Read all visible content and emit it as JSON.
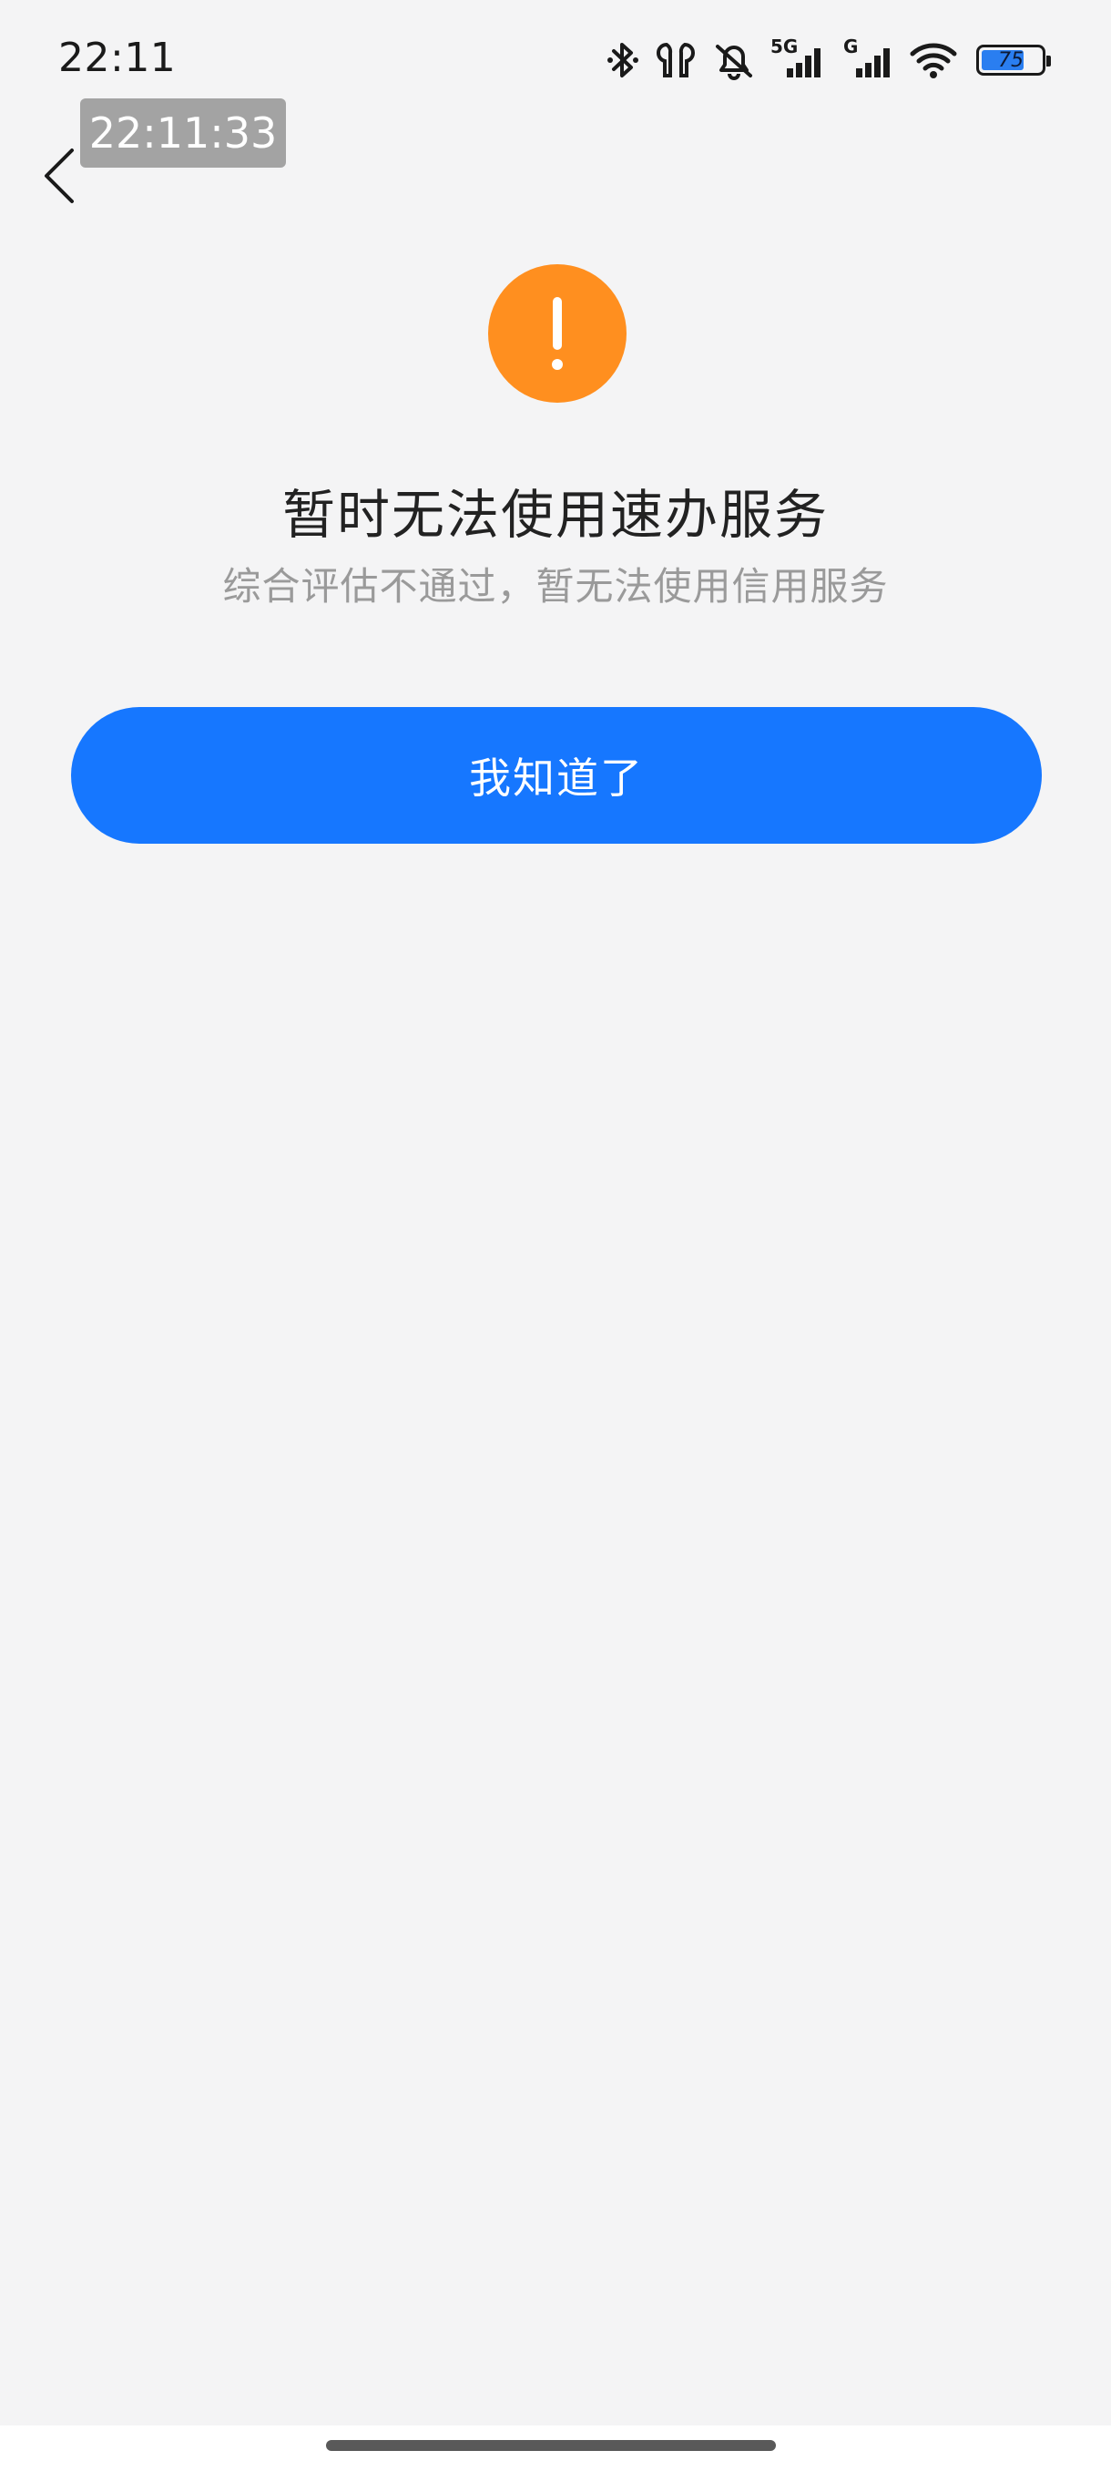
{
  "status_bar": {
    "time": "22:11",
    "network_5g": "5G",
    "network_g": "G",
    "battery_level": "75",
    "icons": [
      "bluetooth-icon",
      "earbuds-icon",
      "mute-icon",
      "signal-5g-icon",
      "signal-g-icon",
      "wifi-icon",
      "battery-icon"
    ]
  },
  "overlay": {
    "timestamp": "22:11:33"
  },
  "nav": {
    "back_icon": "chevron-left-icon"
  },
  "result": {
    "icon": "warning-exclamation-icon",
    "icon_color": "#ff8f1f",
    "title": "暂时无法使用速办服务",
    "message": "综合评估不通过，暂无法使用信用服务"
  },
  "actions": {
    "confirm_label": "我知道了",
    "confirm_color": "#1677ff"
  }
}
